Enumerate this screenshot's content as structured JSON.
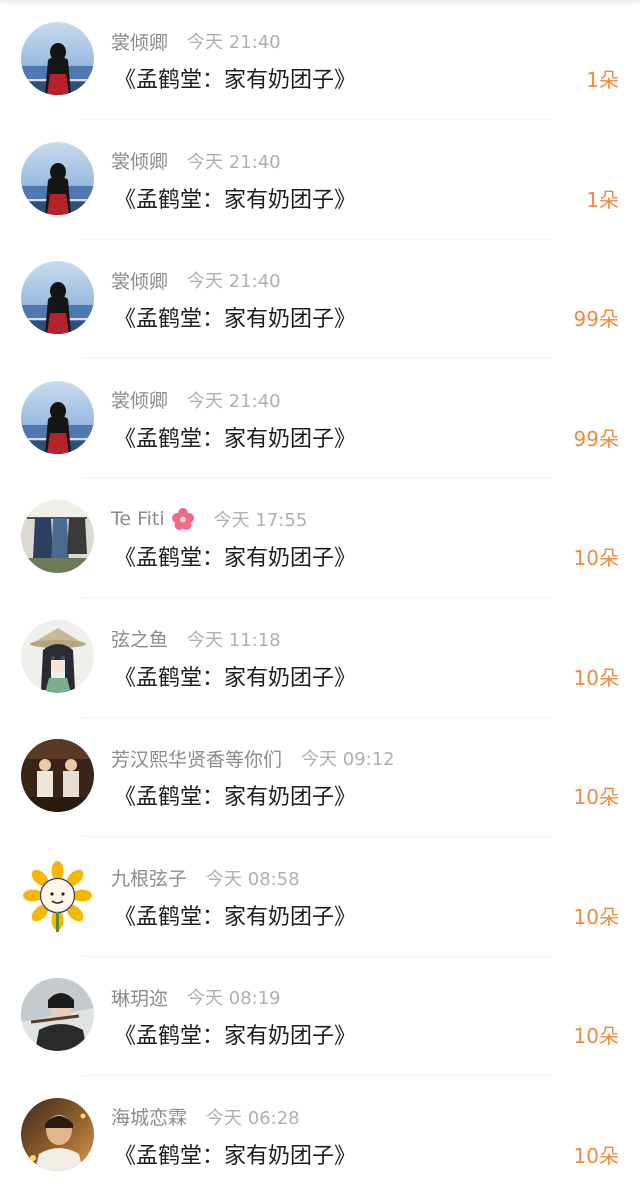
{
  "colors": {
    "username": "#8c8c8c",
    "time": "#b0b0b0",
    "title": "#1e1e1e",
    "count_accent": "#f08a3c",
    "divider": "#f0f0f0"
  },
  "gifts": [
    {
      "user": "裳倾卿",
      "time": "今天 21:40",
      "book": "《孟鹤堂：家有奶团子》",
      "count": "1朵",
      "avatar": "avatar-seaside-girl-icon",
      "badge": null
    },
    {
      "user": "裳倾卿",
      "time": "今天 21:40",
      "book": "《孟鹤堂：家有奶团子》",
      "count": "1朵",
      "avatar": "avatar-seaside-girl-icon",
      "badge": null
    },
    {
      "user": "裳倾卿",
      "time": "今天 21:40",
      "book": "《孟鹤堂：家有奶团子》",
      "count": "99朵",
      "avatar": "avatar-seaside-girl-icon",
      "badge": null
    },
    {
      "user": "裳倾卿",
      "time": "今天 21:40",
      "book": "《孟鹤堂：家有奶团子》",
      "count": "99朵",
      "avatar": "avatar-seaside-girl-icon",
      "badge": null
    },
    {
      "user": "Te Fiti",
      "time": "今天 17:55",
      "book": "《孟鹤堂：家有奶团子》",
      "count": "10朵",
      "avatar": "avatar-clothes-rack-icon",
      "badge": "pink-flower-icon"
    },
    {
      "user": "弦之鱼",
      "time": "今天 11:18",
      "book": "《孟鹤堂：家有奶团子》",
      "count": "10朵",
      "avatar": "avatar-anime-girl-hat-icon",
      "badge": null
    },
    {
      "user": "芳汉熙华贤香等你们",
      "time": "今天 09:12",
      "book": "《孟鹤堂：家有奶团子》",
      "count": "10朵",
      "avatar": "avatar-stage-performers-icon",
      "badge": null
    },
    {
      "user": "九根弦子",
      "time": "今天 08:58",
      "book": "《孟鹤堂：家有奶团子》",
      "count": "10朵",
      "avatar": "avatar-sunflower-face-icon",
      "badge": null
    },
    {
      "user": "琳玥迩",
      "time": "今天 08:19",
      "book": "《孟鹤堂：家有奶团子》",
      "count": "10朵",
      "avatar": "avatar-flute-player-icon",
      "badge": null
    },
    {
      "user": "海城恋霖",
      "time": "今天 06:28",
      "book": "《孟鹤堂：家有奶团子》",
      "count": "10朵",
      "avatar": "avatar-portrait-warm-icon",
      "badge": null
    }
  ]
}
